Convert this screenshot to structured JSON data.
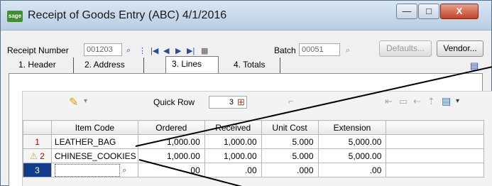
{
  "window": {
    "app_icon": "sage",
    "title": "Receipt of Goods Entry (ABC) 4/1/2016",
    "min_glyph": "—",
    "max_glyph": "□",
    "close_glyph": "X"
  },
  "header": {
    "receipt_number_label": "Receipt Number",
    "receipt_number_value": "001203",
    "batch_label": "Batch",
    "batch_value": "00051",
    "defaults_label": "Defaults...",
    "vendor_label": "Vendor..."
  },
  "tabs": [
    {
      "label": "1. Header"
    },
    {
      "label": "2. Address"
    },
    {
      "label": "3. Lines"
    },
    {
      "label": "4. Totals"
    }
  ],
  "toolbar": {
    "quick_row_label": "Quick Row",
    "quick_row_value": "3"
  },
  "grid": {
    "columns": [
      "Item Code",
      "Ordered",
      "Received",
      "Unit Cost",
      "Extension"
    ],
    "rows": [
      {
        "no": "1",
        "item_code": "LEATHER_BAG",
        "ordered": "1,000.00",
        "received": "1,000.00",
        "unit_cost": "5.000",
        "extension": "5,000.00",
        "warning": false
      },
      {
        "no": "2",
        "item_code": "CHINESE_COOKIES",
        "ordered": "1,000.00",
        "received": "1,000.00",
        "unit_cost": "5.000",
        "extension": "5,000.00",
        "warning": true
      },
      {
        "no": "3",
        "item_code": "",
        "ordered": ".00",
        "received": ".00",
        "unit_cost": ".000",
        "extension": ".00",
        "warning": false
      }
    ]
  },
  "colors": {
    "callout": "#000000",
    "selected_row": "#123c8a",
    "row_number": "#c00000"
  }
}
